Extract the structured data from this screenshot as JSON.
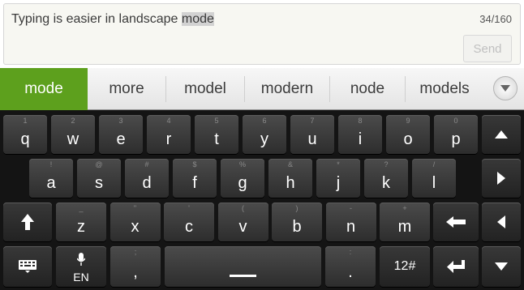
{
  "compose": {
    "message_prefix": "Typing is easier in landscape ",
    "message_highlight": "mode",
    "counter": "34/160",
    "send_label": "Send"
  },
  "suggestions": [
    {
      "label": "mode",
      "selected": true
    },
    {
      "label": "more",
      "selected": false
    },
    {
      "label": "model",
      "selected": false
    },
    {
      "label": "modern",
      "selected": false
    },
    {
      "label": "node",
      "selected": false
    },
    {
      "label": "models",
      "selected": false
    }
  ],
  "keyboard": {
    "row1": [
      {
        "main": "q",
        "hint": "1"
      },
      {
        "main": "w",
        "hint": "2"
      },
      {
        "main": "e",
        "hint": "3"
      },
      {
        "main": "r",
        "hint": "4"
      },
      {
        "main": "t",
        "hint": "5"
      },
      {
        "main": "y",
        "hint": "6"
      },
      {
        "main": "u",
        "hint": "7"
      },
      {
        "main": "i",
        "hint": "8"
      },
      {
        "main": "o",
        "hint": "9"
      },
      {
        "main": "p",
        "hint": "0"
      }
    ],
    "row2": [
      {
        "main": "a",
        "hint": "!"
      },
      {
        "main": "s",
        "hint": "@"
      },
      {
        "main": "d",
        "hint": "#"
      },
      {
        "main": "f",
        "hint": "$"
      },
      {
        "main": "g",
        "hint": "%"
      },
      {
        "main": "h",
        "hint": "&"
      },
      {
        "main": "j",
        "hint": "*"
      },
      {
        "main": "k",
        "hint": "?"
      },
      {
        "main": "l",
        "hint": "/"
      }
    ],
    "row3": [
      {
        "main": "z",
        "hint": "_"
      },
      {
        "main": "x",
        "hint": "\""
      },
      {
        "main": "c",
        "hint": "'"
      },
      {
        "main": "v",
        "hint": "("
      },
      {
        "main": "b",
        "hint": ")"
      },
      {
        "main": "n",
        "hint": "-"
      },
      {
        "main": "m",
        "hint": "+"
      }
    ],
    "row4": {
      "mic_label": "EN",
      "comma": ",",
      "comma_hint": ";",
      "period": ".",
      "period_hint": ":",
      "symbols_label": "12#"
    },
    "icons": {
      "shift": "shift-icon",
      "backspace": "backspace-icon",
      "enter": "enter-icon",
      "keyboard_settings": "keyboard-settings-icon",
      "mic": "microphone-icon",
      "nav_up": "arrow-up-icon",
      "nav_right": "arrow-right-icon",
      "nav_left": "arrow-left-icon",
      "nav_down": "arrow-down-icon",
      "expand": "chevron-down-icon"
    }
  },
  "colors": {
    "suggestion_selected": "#5da01d",
    "keyboard_bg": "#141414"
  }
}
